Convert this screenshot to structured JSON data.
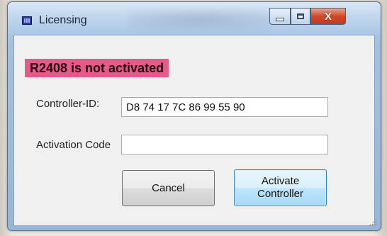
{
  "window": {
    "title": "Licensing",
    "controls": {
      "minimize": "minimize",
      "maximize": "maximize",
      "close": "X"
    }
  },
  "status": {
    "text": "R2408 is not activated",
    "color": "#e45a88"
  },
  "form": {
    "controller_id": {
      "label": "Controller-ID:",
      "value": "D8 74 17 7C 86 99 55 90"
    },
    "activation_code": {
      "label": "Activation Code",
      "value": ""
    }
  },
  "buttons": {
    "cancel": "Cancel",
    "activate_line1": "Activate",
    "activate_line2": "Controller"
  },
  "icons": {
    "app": "licensing-app-icon",
    "grip": "resize-grip-icon"
  }
}
